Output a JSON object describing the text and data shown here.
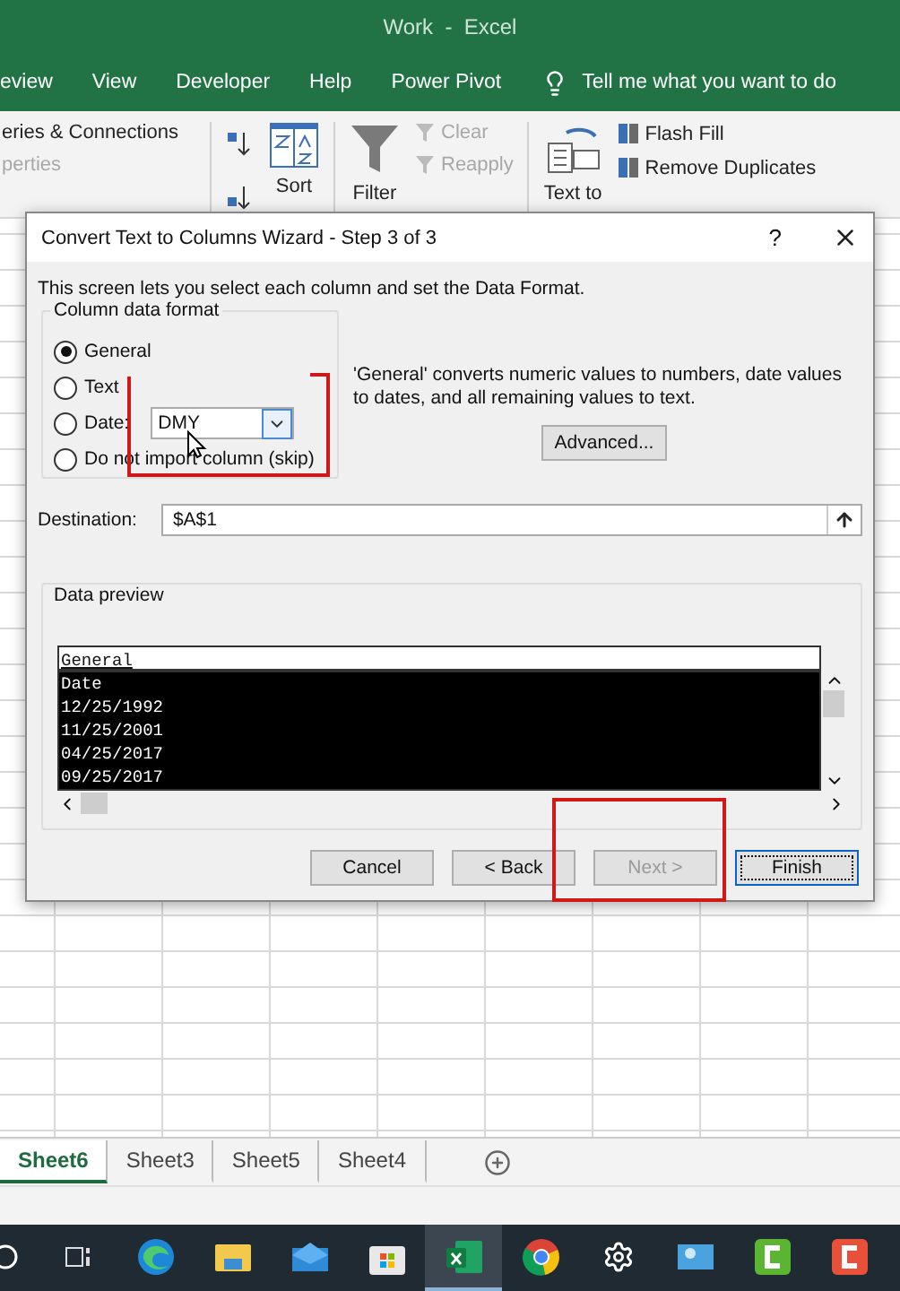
{
  "window": {
    "title": "Work  -  Excel"
  },
  "ribbon_tabs": [
    "eview",
    "View",
    "Developer",
    "Help",
    "Power Pivot"
  ],
  "tell_me": "Tell me what you want to do",
  "ribbon": {
    "queries": [
      {
        "label": "eries & Connections",
        "disabled": false
      },
      {
        "label": "perties",
        "disabled": true
      }
    ],
    "sort": "Sort",
    "filter": "Filter",
    "filter_commands": [
      {
        "label": "Clear",
        "disabled": true
      },
      {
        "label": "Reapply",
        "disabled": true
      }
    ],
    "text_to": "Text to",
    "data_tools": [
      {
        "label": "Flash Fill",
        "disabled": false
      },
      {
        "label": "Remove Duplicates",
        "disabled": false
      }
    ]
  },
  "dialog": {
    "title": "Convert Text to Columns Wizard - Step 3 of 3",
    "help": "?",
    "intro": "This screen lets you select each column and set the Data Format.",
    "format_group": {
      "legend": "Column data format",
      "options": [
        {
          "kind": "radio",
          "label": "General",
          "selected": true
        },
        {
          "kind": "radio",
          "label": "Text",
          "selected": false
        },
        {
          "kind": "date",
          "label": "Date:",
          "selected": false,
          "value": "DMY"
        },
        {
          "kind": "radio",
          "label": "Do not import column (skip)",
          "selected": false
        }
      ]
    },
    "description": "'General' converts numeric values to numbers, date values to dates, and all remaining values to text.",
    "advanced": "Advanced...",
    "destination": {
      "label": "Destination:",
      "value": "$A$1"
    },
    "preview": {
      "legend": "Data preview",
      "header": "General",
      "rows": [
        "Date",
        "12/25/1992",
        "11/25/2001",
        "04/25/2017",
        "09/25/2017"
      ]
    },
    "buttons": [
      {
        "label": "Cancel",
        "disabled": false,
        "default": false
      },
      {
        "label": "< Back",
        "disabled": false,
        "default": false
      },
      {
        "label": "Next >",
        "disabled": true,
        "default": false
      },
      {
        "label": "Finish",
        "disabled": false,
        "default": true
      }
    ]
  },
  "sheets": [
    {
      "label": "Sheet6",
      "selected": true
    },
    {
      "label": "Sheet3",
      "selected": false
    },
    {
      "label": "Sheet5",
      "selected": false
    },
    {
      "label": "Sheet4",
      "selected": false
    }
  ],
  "taskbar": [
    {
      "kind": "search",
      "active": false
    },
    {
      "kind": "taskview",
      "active": false
    },
    {
      "kind": "edge",
      "active": false
    },
    {
      "kind": "folder",
      "active": false
    },
    {
      "kind": "mail",
      "active": false
    },
    {
      "kind": "store",
      "active": false
    },
    {
      "kind": "excel",
      "active": true
    },
    {
      "kind": "chrome",
      "active": false
    },
    {
      "kind": "settings",
      "active": false
    },
    {
      "kind": "photos",
      "active": false
    },
    {
      "kind": "camtasia",
      "active": false
    },
    {
      "kind": "recorder",
      "active": false
    }
  ]
}
